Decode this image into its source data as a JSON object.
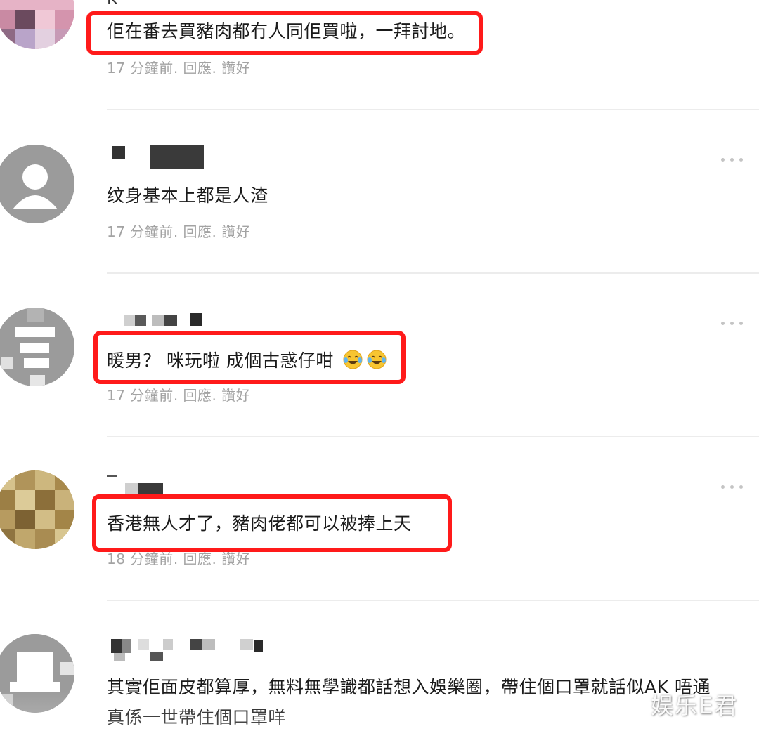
{
  "comments": [
    {
      "username_partial": "K",
      "text": "佢在番去買豬肉都冇人同佢買啦，一拜討地。",
      "time": "17 分鐘前",
      "reply": "回應",
      "like": "讚好"
    },
    {
      "text": "纹身基本上都是人渣",
      "time": "17 分鐘前",
      "reply": "回應",
      "like": "讚好"
    },
    {
      "text": "暖男？ 咪玩啦 成個古惑仔咁",
      "emoji": [
        "face-with-tears-of-joy",
        "face-with-tears-of-joy"
      ],
      "time": "17 分鐘前",
      "reply": "回應",
      "like": "讚好"
    },
    {
      "text": "香港無人才了，豬肉佬都可以被捧上天",
      "time": "18 分鐘前",
      "reply": "回應",
      "like": "讚好"
    },
    {
      "text_line1": "其實佢面皮都算厚，無料無學識都話想入娛樂圈，帶住個口罩就話似AK 唔通",
      "text_line2": "真係一世帶住個口罩咩"
    }
  ],
  "separator": ".",
  "watermark": "娱乐E君",
  "colors": {
    "highlight": "#ff1a1a",
    "meta_text": "#a3a3a3",
    "body_text": "#1a1a1a",
    "avatar_gray": "#9b9b9b"
  },
  "icons": {
    "more": "more-options-icon",
    "emoji": "face-with-tears-of-joy"
  }
}
